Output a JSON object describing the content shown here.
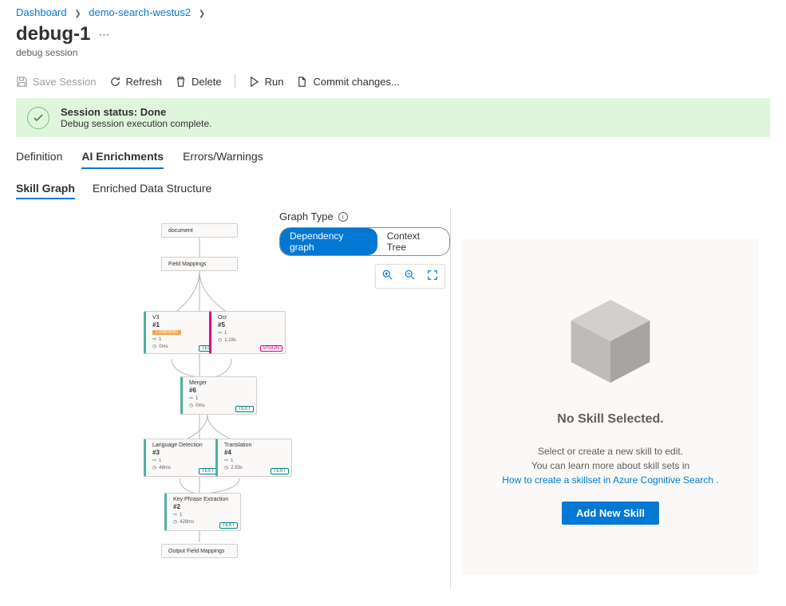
{
  "breadcrumb": {
    "items": [
      "Dashboard",
      "demo-search-westus2"
    ]
  },
  "page": {
    "title": "debug-1",
    "subtitle": "debug session"
  },
  "toolbar": {
    "save": "Save Session",
    "refresh": "Refresh",
    "delete": "Delete",
    "run": "Run",
    "commit": "Commit changes..."
  },
  "status": {
    "title": "Session status: Done",
    "detail": "Debug session execution complete."
  },
  "tabs": {
    "definition": "Definition",
    "ai_enrichments": "AI Enrichments",
    "errors": "Errors/Warnings"
  },
  "subtabs": {
    "skill_graph": "Skill Graph",
    "enriched": "Enriched Data Structure"
  },
  "graph": {
    "type_label": "Graph Type",
    "dep": "Dependency graph",
    "ctx": "Context Tree",
    "nodes": {
      "document": "document",
      "field_mappings": "Field Mappings",
      "n1_title": "V3",
      "n1_index": "#1",
      "n1_warn": "1 WARNING",
      "n1_r1": "1",
      "n1_r2": "0ms",
      "n5_title": "Ocr",
      "n5_index": "#5",
      "n5_r1": "1",
      "n5_r2": "1.19s",
      "n6_title": "Merger",
      "n6_index": "#6",
      "n6_r1": "1",
      "n6_r2": "0ms",
      "n3_title": "Language Detection",
      "n3_index": "#3",
      "n3_r1": "1",
      "n3_r2": "48ms",
      "n4_title": "Translation",
      "n4_index": "#4",
      "n4_r1": "1",
      "n4_r2": "2.93s",
      "n2_title": "Key Phrase Extraction",
      "n2_index": "#2",
      "n2_r1": "1",
      "n2_r2": "429ms",
      "output": "Output Field Mappings",
      "badge_text": "TEXT",
      "badge_vision": "VISION"
    }
  },
  "placeholder": {
    "title": "No Skill Selected.",
    "line1": "Select or create a new skill to edit.",
    "line2": "You can learn more about skill sets in",
    "link": "How to create a skillset in Azure Cognitive Search .",
    "button": "Add New Skill"
  }
}
